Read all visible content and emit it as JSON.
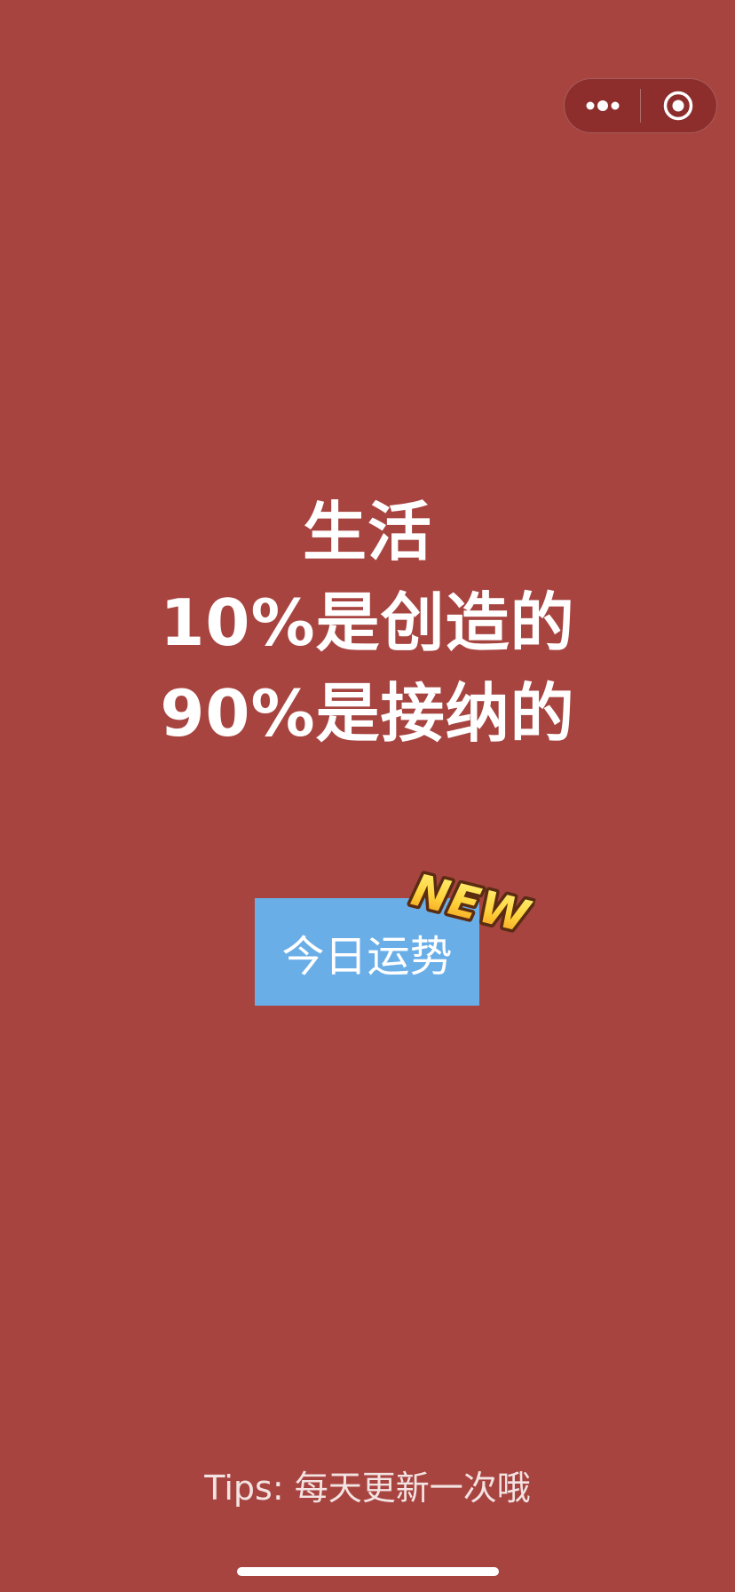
{
  "colors": {
    "background": "#a74440",
    "button": "#6aaee8",
    "text": "#ffffff",
    "badge_fill": "#ffd23a",
    "badge_outline": "#5a2c12"
  },
  "capsule": {
    "more_icon": "more-dots-icon",
    "close_icon": "target-circle-icon"
  },
  "quote": {
    "line1": "生活",
    "line2": "10%是创造的",
    "line3": "90%是接纳的"
  },
  "fortune_button": {
    "label": "今日运势"
  },
  "badge": {
    "label": "NEW"
  },
  "tips": {
    "text": "Tips: 每天更新一次哦"
  }
}
